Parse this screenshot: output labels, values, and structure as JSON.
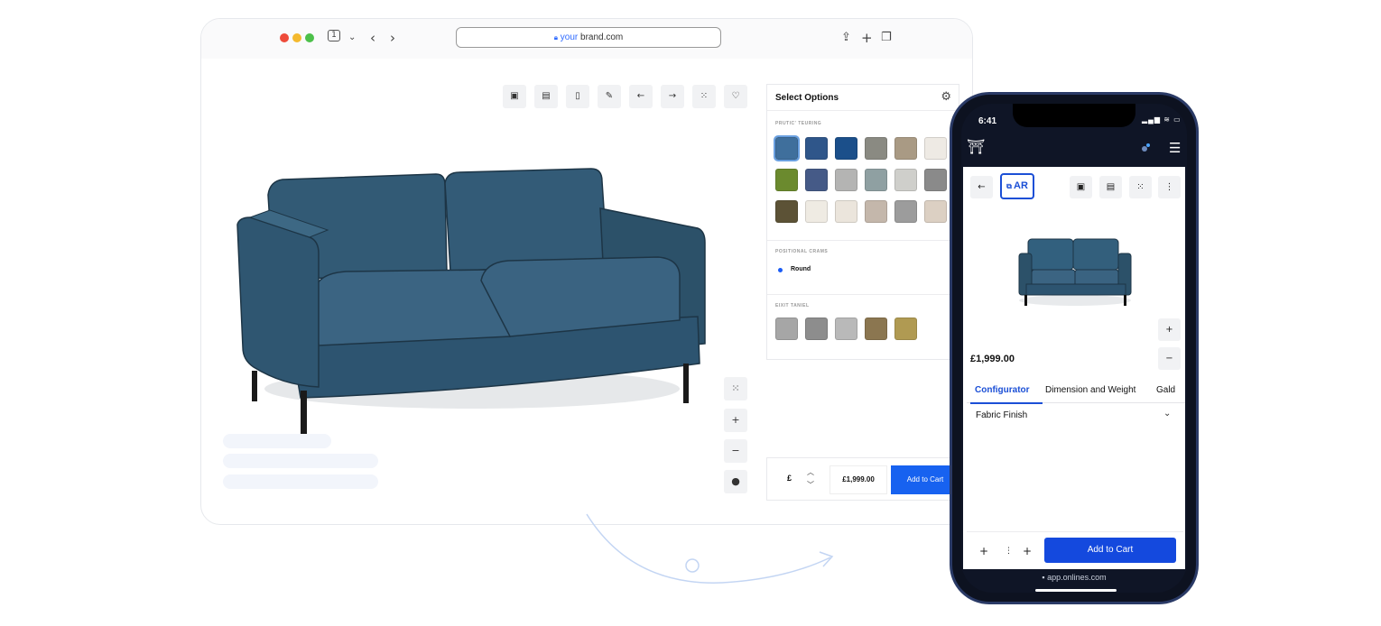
{
  "browser": {
    "url_prefix": "your",
    "url_domain": "brand.com",
    "tab_count": "1",
    "traffic_lights": [
      "#ee4b3a",
      "#f4b92e",
      "#4cc04a"
    ],
    "toolbar_icons": [
      "ar-box-icon",
      "ar-box-icon",
      "document-icon",
      "ruler-icon",
      "arrow-left-icon",
      "arrow-right-icon",
      "grid-icon",
      "heart-icon"
    ],
    "side_controls": [
      "expand-icon",
      "zoom-in-icon",
      "zoom-out-icon",
      "info-icon"
    ]
  },
  "options_panel": {
    "title": "Select Options",
    "sections": [
      {
        "label": "PRUTIC' TEURING",
        "swatches": [
          "#3f6f9c",
          "#2f568a",
          "#1b4f8a",
          "#8a8a82",
          "#a99a84",
          "#eeeae4",
          "#6b8a2e",
          "#455a87",
          "#b4b4b3",
          "#8fa0a2",
          "#cfcfcb",
          "#8a8a8a",
          "#5c5236",
          "#efebe3",
          "#ebe5dc",
          "#c4b7ab",
          "#9c9c9c",
          "#dcd0c3"
        ]
      },
      {
        "label": "POSITIONAL CRAMS",
        "option": "Round"
      },
      {
        "label": "EIXIT TANIEL",
        "swatches": [
          "#a6a6a6",
          "#8d8d8d",
          "#b9b9b9",
          "#8b7650",
          "#b09a52"
        ]
      }
    ]
  },
  "cart": {
    "currency": "£",
    "price": "£1,999.00",
    "add_label": "Add to Cart",
    "accent": "#1762f0"
  },
  "phone": {
    "time": "6:41",
    "status": "▂▄▆ ≋ ▭",
    "ar_label": "AR",
    "price": "£1,999.00",
    "tabs": [
      "Configurator",
      "Dimension and Weight",
      "Gald"
    ],
    "section": "Fabric Finish",
    "add_label": "Add to Cart",
    "url": "app.onlines.com",
    "accent": "#1449de"
  }
}
